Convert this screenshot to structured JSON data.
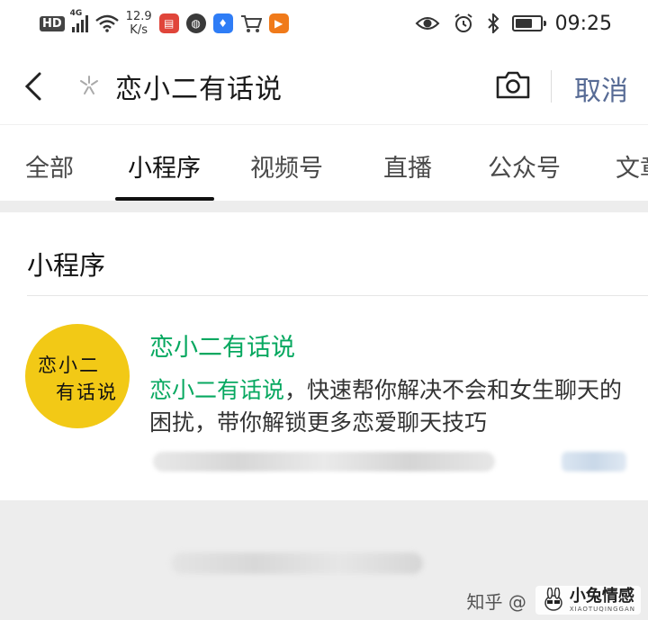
{
  "status_bar": {
    "hd": "HD",
    "network": "4G",
    "speed_value": "12.9",
    "speed_unit": "K/s",
    "time": "09:25",
    "battery_level": 0.7,
    "apps": [
      {
        "name": "book-app-icon",
        "color": "#e0453a",
        "glyph": "▤"
      },
      {
        "name": "ball-app-icon",
        "color": "#3a3a3a",
        "glyph": "◍"
      },
      {
        "name": "bulb-app-icon",
        "color": "#2f7df6",
        "glyph": "♦"
      },
      {
        "name": "cart-app-icon",
        "color": "#ffffff",
        "glyph": "🛒"
      },
      {
        "name": "play-app-icon",
        "color": "#f07a1a",
        "glyph": "▶"
      }
    ]
  },
  "search": {
    "query": "恋小二有话说",
    "cancel_label": "取消"
  },
  "tabs": [
    {
      "label": "全部",
      "active": false
    },
    {
      "label": "小程序",
      "active": true
    },
    {
      "label": "视频号",
      "active": false
    },
    {
      "label": "直播",
      "active": false
    },
    {
      "label": "公众号",
      "active": false
    },
    {
      "label": "文章",
      "active": false
    }
  ],
  "results": {
    "section_title": "小程序",
    "item": {
      "name": "恋小二有话说",
      "desc_highlight": "恋小二有话说",
      "desc_rest": "，快速帮你解决不会和女生聊天的困扰，带你解锁更多恋爱聊天技巧",
      "logo_line1": "恋小二",
      "logo_line2": "有话说"
    }
  },
  "watermark": {
    "zhihu": "知乎 @",
    "brand": "小兔情感",
    "brand_sub": "XIAOTUQINGGAN"
  },
  "colors": {
    "accent_green": "#07a860",
    "link_blue": "#576b95",
    "logo_yellow": "#f2c916"
  }
}
